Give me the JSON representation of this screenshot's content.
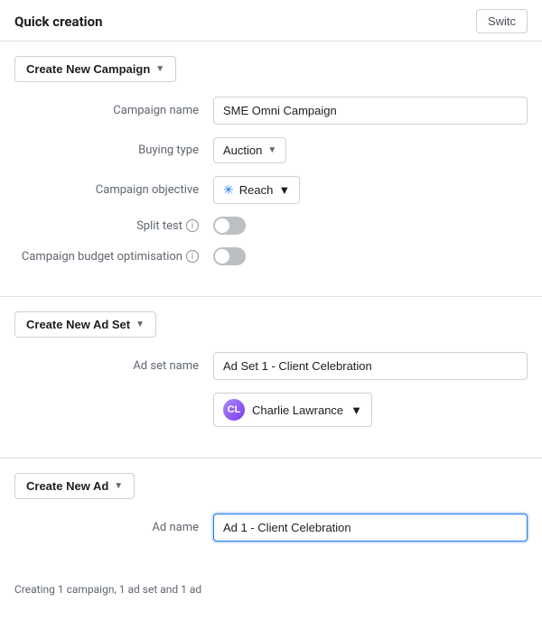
{
  "header": {
    "title": "Quick creation",
    "switch_label": "Switc"
  },
  "campaign_section": {
    "button_label": "Create New Campaign",
    "fields": {
      "campaign_name": {
        "label": "Campaign name",
        "value": "SME Omni Campaign"
      },
      "buying_type": {
        "label": "Buying type",
        "value": "Auction"
      },
      "campaign_objective": {
        "label": "Campaign objective",
        "value": "Reach"
      },
      "split_test": {
        "label": "Split test",
        "checked": false
      },
      "campaign_budget_optimisation": {
        "label": "Campaign budget optimisation",
        "checked": false
      }
    }
  },
  "adset_section": {
    "button_label": "Create New Ad Set",
    "fields": {
      "ad_set_name": {
        "label": "Ad set name",
        "value": "Ad Set 1 - Client Celebration"
      },
      "account": {
        "name": "Charlie Lawrance"
      }
    }
  },
  "ad_section": {
    "button_label": "Create New Ad",
    "fields": {
      "ad_name": {
        "label": "Ad name",
        "value": "Ad 1 - Client Celebration"
      }
    }
  },
  "footer": {
    "text": "Creating 1 campaign, 1 ad set and 1 ad"
  }
}
